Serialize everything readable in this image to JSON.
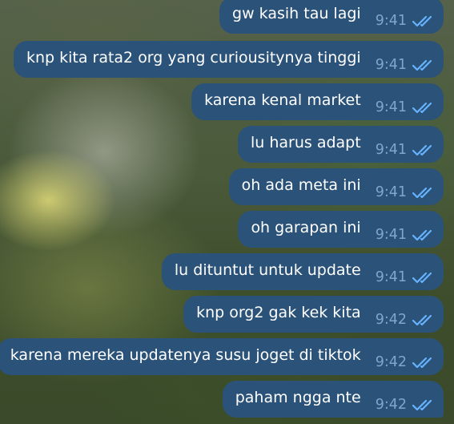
{
  "theme": {
    "bubble_color": "#2b5278",
    "text_color": "#ffffff",
    "time_color": "#7da7cf",
    "read_tick_color": "#66b3ff"
  },
  "messages": [
    {
      "text": "gw kasih tau lagi",
      "time": "9:41",
      "status": "read-double-check-icon"
    },
    {
      "text": "knp kita rata2 org yang curiousitynya tinggi",
      "time": "9:41",
      "status": "read-double-check-icon"
    },
    {
      "text": "karena kenal market",
      "time": "9:41",
      "status": "read-double-check-icon"
    },
    {
      "text": "lu harus adapt",
      "time": "9:41",
      "status": "read-double-check-icon"
    },
    {
      "text": "oh ada meta ini",
      "time": "9:41",
      "status": "read-double-check-icon"
    },
    {
      "text": "oh garapan ini",
      "time": "9:41",
      "status": "read-double-check-icon"
    },
    {
      "text": "lu dituntut untuk update",
      "time": "9:41",
      "status": "read-double-check-icon"
    },
    {
      "text": "knp org2 gak kek kita",
      "time": "9:42",
      "status": "read-double-check-icon"
    },
    {
      "text": "karena mereka updatenya susu joget di tiktok",
      "time": "9:42",
      "status": "read-double-check-icon"
    },
    {
      "text": "paham ngga nte",
      "time": "9:42",
      "status": "read-double-check-icon"
    }
  ]
}
